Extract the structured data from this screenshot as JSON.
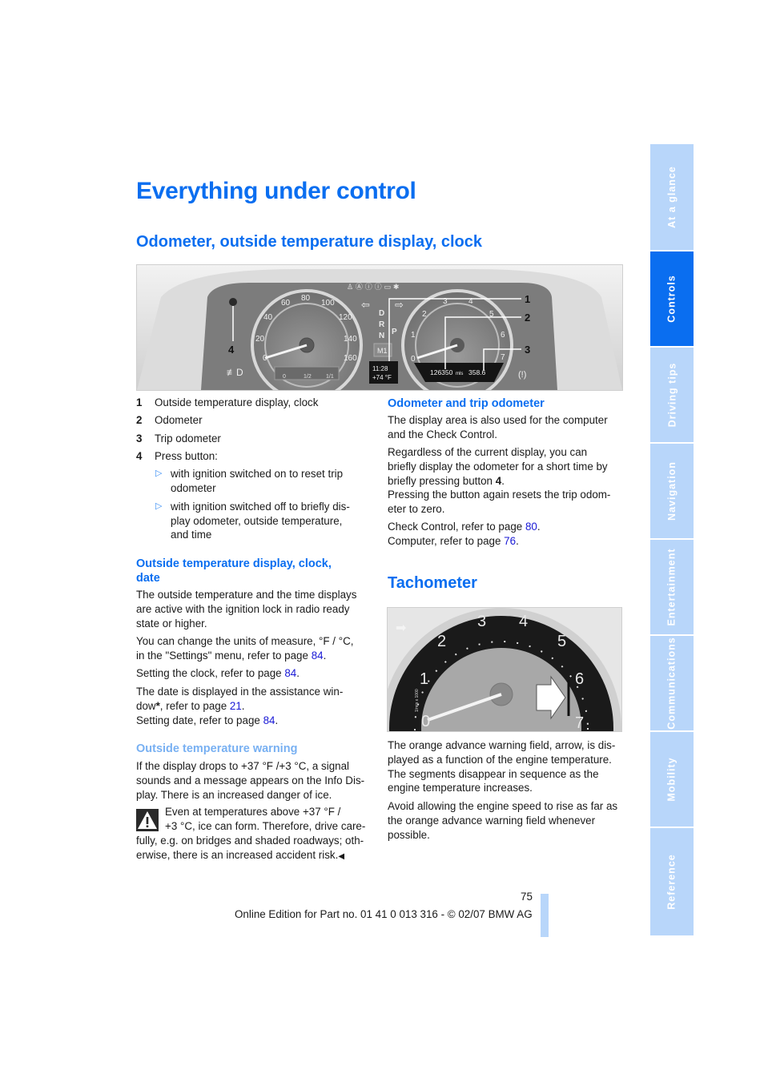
{
  "page": {
    "title": "Everything under control",
    "section1": {
      "heading": "Odometer, outside temperature display, clock",
      "figure": {
        "callouts": [
          "1",
          "2",
          "3",
          "4"
        ],
        "speedometer_ticks": [
          "0",
          "20",
          "40",
          "60",
          "80",
          "100",
          "120",
          "140",
          "160"
        ],
        "tachometer_ticks": [
          "0",
          "1",
          "2",
          "3",
          "4",
          "5",
          "6",
          "7"
        ],
        "gear_letters": [
          "D",
          "R",
          "N",
          "D",
          "P"
        ],
        "clock_display": "11:28",
        "temp_display": "+74 °F",
        "odometer_display": "126350",
        "odometer_unit": "mls",
        "trip_display": "358.6",
        "fuel_labels": [
          "0",
          "1/2",
          "1/1"
        ],
        "mode_display": "M1"
      },
      "items": [
        {
          "num": "1",
          "text": "Outside temperature display, clock"
        },
        {
          "num": "2",
          "text": "Odometer"
        },
        {
          "num": "3",
          "text": "Trip odometer"
        },
        {
          "num": "4",
          "text": "Press button:"
        }
      ],
      "bullets": [
        "with ignition switched on to reset trip odometer",
        "with ignition switched off to briefly display odometer, outside temperature, and time"
      ],
      "bullet_lines": [
        [
          "with ignition switched on to reset trip",
          "odometer"
        ],
        [
          "with ignition switched off to briefly dis-",
          "play odometer, outside temperature,",
          "and time"
        ]
      ]
    },
    "temp_clock_date": {
      "heading_line1": "Outside temperature display, clock,",
      "heading_line2": "date",
      "p1": [
        "The outside temperature and the time displays",
        "are active with the ignition lock in radio ready",
        "state or higher."
      ],
      "p2_line1": "You can change the units of measure, °F / °C,",
      "p2_line2_pre": "in the \"Settings\" menu, refer to page ",
      "p2_link": "84",
      "p3_pre": "Setting the clock, refer to page ",
      "p3_link": "84",
      "p4_line1": "The date is displayed in the assistance win-",
      "p4_line2_pre": "dow",
      "p4_star": "*",
      "p4_line2_mid": ", refer to page ",
      "p4_link": "21",
      "p5_pre": "Setting date, refer to page ",
      "p5_link": "84"
    },
    "temp_warning": {
      "heading": "Outside temperature warning",
      "p1": [
        "If the display drops to +37 °F /+3 °C, a signal",
        "sounds and a message appears on the Info Dis-",
        "play. There is an increased danger of ice."
      ],
      "warn_lines": [
        "Even at temperatures above +37 °F /",
        "+3 °C, ice can form. Therefore, drive care-",
        "fully, e.g. on bridges and shaded roadways; oth-",
        "erwise, there is an increased accident risk."
      ],
      "end_mark": "◀"
    },
    "odometer_trip": {
      "heading": "Odometer and trip odometer",
      "p1": [
        "The display area is also used for the computer",
        "and the Check Control."
      ],
      "p2": [
        "Regardless of the current display, you can",
        "briefly display the odometer for a short time by"
      ],
      "p2_last_pre": "briefly pressing button ",
      "p2_last_bold": "4",
      "p3": [
        "Pressing the button again resets the trip odom-",
        "eter to zero."
      ],
      "p4_pre": "Check Control, refer to page ",
      "p4_link": "80",
      "p5_pre": "Computer, refer to page ",
      "p5_link": "76"
    },
    "tachometer": {
      "heading": "Tachometer",
      "figure": {
        "ticks": [
          "0",
          "1",
          "2",
          "3",
          "4",
          "5",
          "6",
          "7"
        ],
        "unit_label": "1/min x 1000"
      },
      "p1": [
        "The orange advance warning field, arrow, is dis-",
        "played as a function of the engine temperature.",
        "The segments disappear in sequence as the",
        "engine temperature increases."
      ],
      "p2": [
        "Avoid allowing the engine speed to rise as far as",
        "the orange advance warning field whenever",
        "possible."
      ]
    },
    "footer": {
      "page_number": "75",
      "edition": "Online Edition for Part no. 01 41 0 013 316 - © 02/07 BMW AG"
    }
  },
  "side_tabs": [
    {
      "label": "At a glance",
      "active": false
    },
    {
      "label": "Controls",
      "active": true
    },
    {
      "label": "Driving tips",
      "active": false
    },
    {
      "label": "Navigation",
      "active": false
    },
    {
      "label": "Entertainment",
      "active": false
    },
    {
      "label": "Communications",
      "active": false
    },
    {
      "label": "Mobility",
      "active": false
    },
    {
      "label": "Reference",
      "active": false
    }
  ],
  "colors": {
    "heading_blue": "#0a6ef0",
    "light_heading_blue": "#78b0f2",
    "tab_inactive": "#b8d6fa",
    "tab_active": "#0a6ef0",
    "link_blue": "#1a1ad6"
  }
}
